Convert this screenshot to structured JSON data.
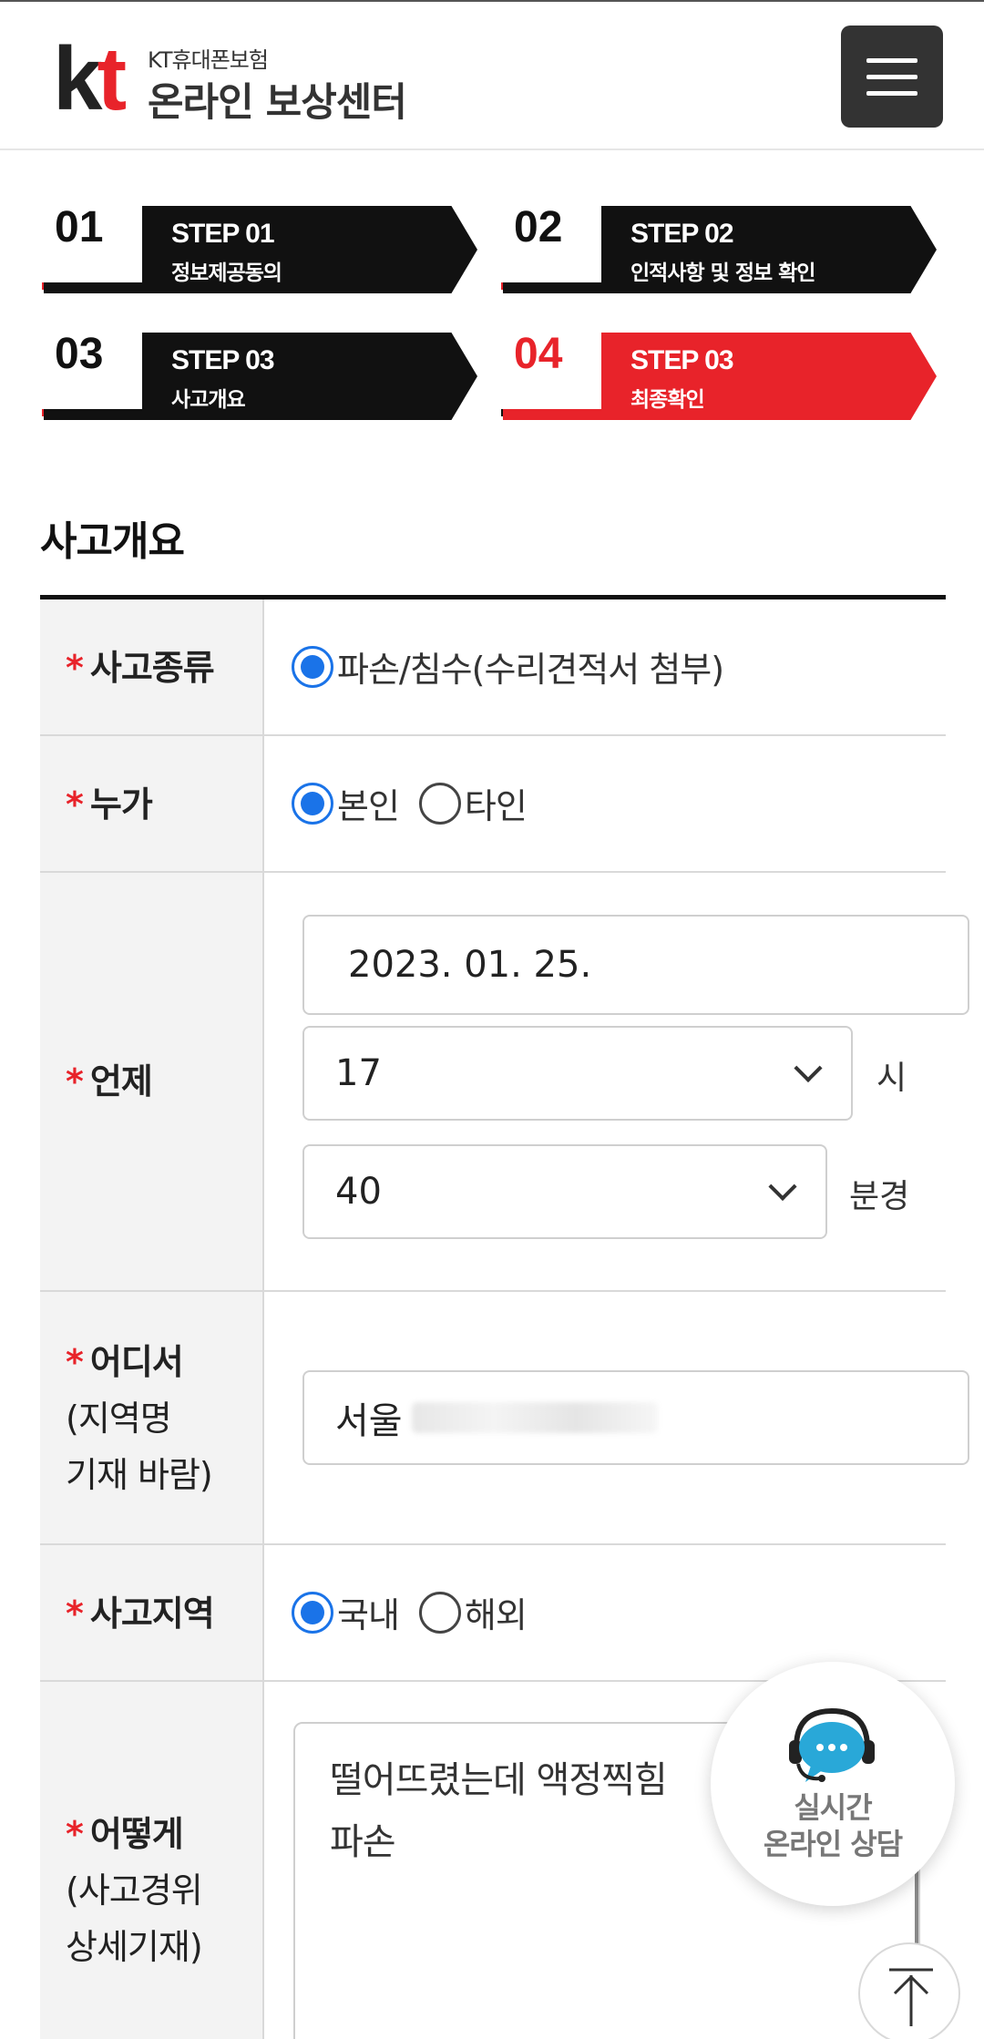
{
  "header": {
    "logo_kt": "kt",
    "logo_top": "KT휴대폰보험",
    "logo_main": "온라인 보상센터",
    "menu_icon": "hamburger-menu-icon"
  },
  "steps": [
    {
      "num": "01",
      "title": "STEP 01",
      "sub": "정보제공동의",
      "active": false
    },
    {
      "num": "02",
      "title": "STEP 02",
      "sub": "인적사항 및 정보 확인",
      "active": false
    },
    {
      "num": "03",
      "title": "STEP 03",
      "sub": "사고개요",
      "active": false
    },
    {
      "num": "04",
      "title": "STEP 03",
      "sub": "최종확인",
      "active": true
    }
  ],
  "section": {
    "title": "사고개요"
  },
  "form": {
    "accident_type": {
      "required": "*",
      "label": "사고종류",
      "options": [
        {
          "label": "파손/침수(수리견적서 첨부)",
          "selected": true
        }
      ]
    },
    "who": {
      "required": "*",
      "label": "누가",
      "options": [
        {
          "label": "본인",
          "selected": true
        },
        {
          "label": "타인",
          "selected": false
        }
      ]
    },
    "when": {
      "required": "*",
      "label": "언제",
      "date": "2023. 01. 25.",
      "hour": "17",
      "hour_unit": "시",
      "minute": "40",
      "minute_unit": "분경"
    },
    "where": {
      "required": "*",
      "label": "어디서",
      "sub1": "(지역명",
      "sub2": "기재 바람)",
      "value": "서울"
    },
    "region": {
      "required": "*",
      "label": "사고지역",
      "options": [
        {
          "label": "국내",
          "selected": true
        },
        {
          "label": "해외",
          "selected": false
        }
      ]
    },
    "how": {
      "required": "*",
      "label": "어떻게",
      "sub1": "(사고경위",
      "sub2": "상세기재)",
      "value_line1": "떨어뜨렸는데 액정찍힘",
      "value_line2": "파손"
    }
  },
  "chat": {
    "icon": "chat-headset-icon",
    "line1": "실시간",
    "line2": "온라인 상담"
  },
  "top_button": {
    "icon": "arrow-up-icon"
  },
  "colors": {
    "accent": "#e8232a",
    "radio": "#1a73e8",
    "dark": "#111111",
    "chat": "#29a8d8"
  }
}
